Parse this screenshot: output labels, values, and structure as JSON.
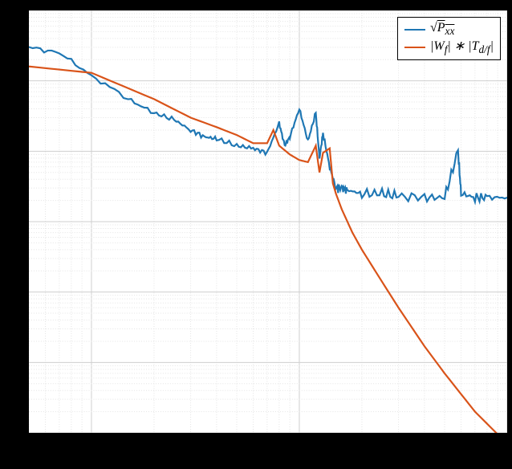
{
  "chart_data": {
    "type": "line",
    "title": "",
    "xlabel": "",
    "ylabel": "",
    "xscale": "log",
    "yscale": "log",
    "xlim": [
      0.5,
      100
    ],
    "ylim": [
      1e-06,
      1
    ],
    "grid": true,
    "legend_position": "upper right",
    "series": [
      {
        "name": "\\sqrt{P_{xx}}",
        "legend_label_html": "√<span style='text-decoration:overline'>P<sub>xx</sub></span>",
        "color": "#1f77b4",
        "x": [
          0.5,
          0.7,
          1,
          1.5,
          2,
          2.5,
          3,
          3.5,
          4,
          5,
          6,
          7,
          8,
          8.5,
          9,
          10,
          11,
          12,
          12.5,
          13,
          14,
          15,
          16,
          17,
          20,
          25,
          30,
          40,
          50,
          58,
          60,
          70,
          80,
          100
        ],
        "y": [
          0.3,
          0.25,
          0.12,
          0.055,
          0.035,
          0.028,
          0.02,
          0.016,
          0.015,
          0.012,
          0.011,
          0.0095,
          0.025,
          0.012,
          0.016,
          0.04,
          0.014,
          0.035,
          0.008,
          0.018,
          0.006,
          0.003,
          0.003,
          0.0028,
          0.0025,
          0.0025,
          0.0023,
          0.0022,
          0.0022,
          0.01,
          0.0025,
          0.0022,
          0.0022,
          0.0022
        ],
        "note": "noisy trace; flattens to noise floor ~0.0022 above ~15"
      },
      {
        "name": "|W_f| * |T_{d/f}|",
        "legend_label_html": "|W<sub>f</sub>| ∗ |T<sub>d/f</sub>|",
        "color": "#d95319",
        "x": [
          0.5,
          1,
          2,
          3,
          4,
          5,
          6,
          7,
          7.5,
          8,
          9,
          10,
          11,
          12,
          12.5,
          13,
          14,
          14.5,
          15,
          16,
          18,
          20,
          25,
          30,
          40,
          50,
          70,
          100
        ],
        "y": [
          0.16,
          0.13,
          0.055,
          0.03,
          0.022,
          0.017,
          0.013,
          0.013,
          0.02,
          0.012,
          0.009,
          0.0075,
          0.007,
          0.012,
          0.005,
          0.0095,
          0.011,
          0.0035,
          0.0025,
          0.0015,
          0.0007,
          0.0004,
          0.00014,
          6e-05,
          1.7e-05,
          7e-06,
          2e-06,
          7e-07
        ],
        "note": "smooth curve with small resonance bumps between ~7 and ~14, then steep roll-off"
      }
    ]
  },
  "legend": {
    "items": [
      {
        "label_html": "√<span style='text-decoration:overline'><i>P<sub>xx</sub></i></span>",
        "color": "#1f77b4"
      },
      {
        "label_html": "|<i>W<sub>f</sub></i>| ∗ |<i>T<sub>d/f</sub></i>|",
        "color": "#d95319"
      }
    ]
  },
  "axes": {
    "x_major_ticks": [
      1,
      10,
      100
    ],
    "x_minor_ticks": [
      0.5,
      0.6,
      0.7,
      0.8,
      0.9,
      2,
      3,
      4,
      5,
      6,
      7,
      8,
      9,
      20,
      30,
      40,
      50,
      60,
      70,
      80,
      90
    ],
    "y_major_ticks": [
      1e-06,
      1e-05,
      0.0001,
      0.001,
      0.01,
      0.1,
      1
    ],
    "y_minor_ticks_per_decade": [
      2,
      3,
      4,
      5,
      6,
      7,
      8,
      9
    ]
  }
}
